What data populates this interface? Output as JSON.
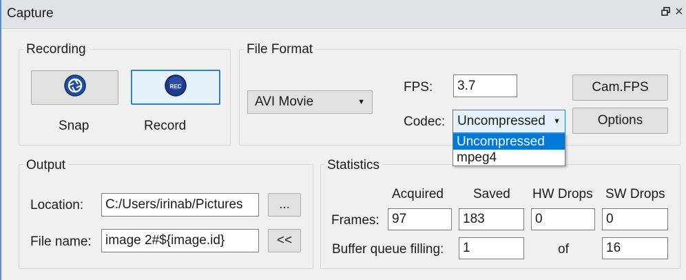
{
  "window": {
    "title": "Capture",
    "restore_icon": "restore-icon",
    "close_icon": "close-icon",
    "close_glyph": "×"
  },
  "recording": {
    "title": "Recording",
    "snap": {
      "label": "Snap",
      "icon": "camera-shutter-icon"
    },
    "record": {
      "label": "Record",
      "icon": "record-icon",
      "icon_text": "REC"
    }
  },
  "file_format": {
    "title": "File Format",
    "format_value": "AVI Movie",
    "fps_label": "FPS:",
    "fps_value": "3.7",
    "codec_label": "Codec:",
    "codec_value": "Uncompressed",
    "codec_options": [
      "Uncompressed",
      "mpeg4"
    ],
    "cam_fps_button": "Cam.FPS",
    "options_button": "Options"
  },
  "output": {
    "title": "Output",
    "location_label": "Location:",
    "location_value": "C:/Users/irinab/Pictures",
    "browse_button": "...",
    "filename_label": "File name:",
    "filename_value": "image 2#${image.id}",
    "insert_button": "<<"
  },
  "statistics": {
    "title": "Statistics",
    "headers": [
      "Acquired",
      "Saved",
      "HW Drops",
      "SW Drops"
    ],
    "frames_label": "Frames:",
    "frames_values": [
      "97",
      "183",
      "0",
      "0"
    ],
    "buffer_label": "Buffer queue filling:",
    "buffer_value": "1",
    "of_label": "of",
    "buffer_total": "16"
  },
  "colors": {
    "accent": "#2d7fd3",
    "selection": "#0078d7",
    "record_icon": "#1f3a8a"
  }
}
